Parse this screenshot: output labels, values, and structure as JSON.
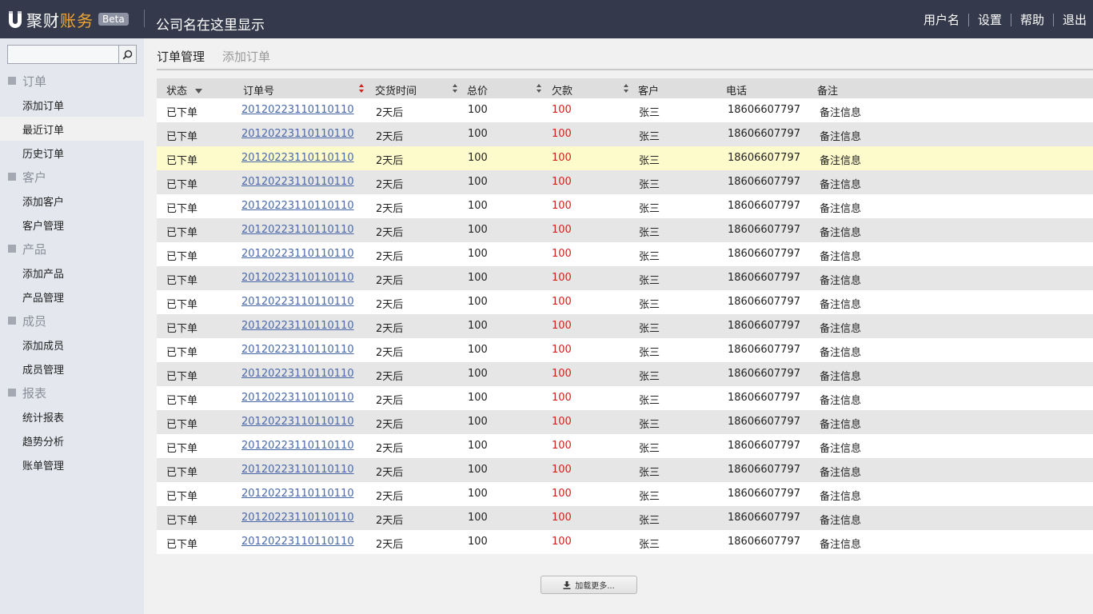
{
  "brand": {
    "name_a": "聚财",
    "name_b": "账务",
    "beta": "Beta",
    "accent": "#f0a632"
  },
  "company": "公司名在这里显示",
  "topnav": {
    "username": "用户名",
    "settings": "设置",
    "help": "帮助",
    "logout": "退出"
  },
  "search": {
    "placeholder": "",
    "icon": "search-icon"
  },
  "sidebar": {
    "groups": [
      {
        "title": "订单",
        "items": [
          "添加订单",
          "最近订单",
          "历史订单"
        ]
      },
      {
        "title": "客户",
        "items": [
          "添加客户",
          "客户管理"
        ]
      },
      {
        "title": "产品",
        "items": [
          "添加产品",
          "产品管理"
        ]
      },
      {
        "title": "成员",
        "items": [
          "添加成员",
          "成员管理"
        ]
      },
      {
        "title": "报表",
        "items": [
          "统计报表",
          "趋势分析",
          "账单管理"
        ]
      }
    ],
    "active_item": "最近订单"
  },
  "tabs": {
    "active": "订单管理",
    "inactive": "添加订单"
  },
  "table": {
    "headers": {
      "status": "状态",
      "order_no": "订单号",
      "delivery": "交货时间",
      "total": "总价",
      "debt": "欠款",
      "customer": "客户",
      "phone": "电话",
      "note": "备注"
    },
    "highlight_row": 3,
    "rows": [
      {
        "status": "已下单",
        "order_no": "20120223110110110",
        "delivery": "2天后",
        "total": "100",
        "debt": "100",
        "customer": "张三",
        "phone": "18606607797",
        "note": "备注信息"
      },
      {
        "status": "已下单",
        "order_no": "20120223110110110",
        "delivery": "2天后",
        "total": "100",
        "debt": "100",
        "customer": "张三",
        "phone": "18606607797",
        "note": "备注信息"
      },
      {
        "status": "已下单",
        "order_no": "20120223110110110",
        "delivery": "2天后",
        "total": "100",
        "debt": "100",
        "customer": "张三",
        "phone": "18606607797",
        "note": "备注信息"
      },
      {
        "status": "已下单",
        "order_no": "20120223110110110",
        "delivery": "2天后",
        "total": "100",
        "debt": "100",
        "customer": "张三",
        "phone": "18606607797",
        "note": "备注信息"
      },
      {
        "status": "已下单",
        "order_no": "20120223110110110",
        "delivery": "2天后",
        "total": "100",
        "debt": "100",
        "customer": "张三",
        "phone": "18606607797",
        "note": "备注信息"
      },
      {
        "status": "已下单",
        "order_no": "20120223110110110",
        "delivery": "2天后",
        "total": "100",
        "debt": "100",
        "customer": "张三",
        "phone": "18606607797",
        "note": "备注信息"
      },
      {
        "status": "已下单",
        "order_no": "20120223110110110",
        "delivery": "2天后",
        "total": "100",
        "debt": "100",
        "customer": "张三",
        "phone": "18606607797",
        "note": "备注信息"
      },
      {
        "status": "已下单",
        "order_no": "20120223110110110",
        "delivery": "2天后",
        "total": "100",
        "debt": "100",
        "customer": "张三",
        "phone": "18606607797",
        "note": "备注信息"
      },
      {
        "status": "已下单",
        "order_no": "20120223110110110",
        "delivery": "2天后",
        "total": "100",
        "debt": "100",
        "customer": "张三",
        "phone": "18606607797",
        "note": "备注信息"
      },
      {
        "status": "已下单",
        "order_no": "20120223110110110",
        "delivery": "2天后",
        "total": "100",
        "debt": "100",
        "customer": "张三",
        "phone": "18606607797",
        "note": "备注信息"
      },
      {
        "status": "已下单",
        "order_no": "20120223110110110",
        "delivery": "2天后",
        "total": "100",
        "debt": "100",
        "customer": "张三",
        "phone": "18606607797",
        "note": "备注信息"
      },
      {
        "status": "已下单",
        "order_no": "20120223110110110",
        "delivery": "2天后",
        "total": "100",
        "debt": "100",
        "customer": "张三",
        "phone": "18606607797",
        "note": "备注信息"
      },
      {
        "status": "已下单",
        "order_no": "20120223110110110",
        "delivery": "2天后",
        "total": "100",
        "debt": "100",
        "customer": "张三",
        "phone": "18606607797",
        "note": "备注信息"
      },
      {
        "status": "已下单",
        "order_no": "20120223110110110",
        "delivery": "2天后",
        "total": "100",
        "debt": "100",
        "customer": "张三",
        "phone": "18606607797",
        "note": "备注信息"
      },
      {
        "status": "已下单",
        "order_no": "20120223110110110",
        "delivery": "2天后",
        "total": "100",
        "debt": "100",
        "customer": "张三",
        "phone": "18606607797",
        "note": "备注信息"
      },
      {
        "status": "已下单",
        "order_no": "20120223110110110",
        "delivery": "2天后",
        "total": "100",
        "debt": "100",
        "customer": "张三",
        "phone": "18606607797",
        "note": "备注信息"
      },
      {
        "status": "已下单",
        "order_no": "20120223110110110",
        "delivery": "2天后",
        "total": "100",
        "debt": "100",
        "customer": "张三",
        "phone": "18606607797",
        "note": "备注信息"
      },
      {
        "status": "已下单",
        "order_no": "20120223110110110",
        "delivery": "2天后",
        "total": "100",
        "debt": "100",
        "customer": "张三",
        "phone": "18606607797",
        "note": "备注信息"
      },
      {
        "status": "已下单",
        "order_no": "20120223110110110",
        "delivery": "2天后",
        "total": "100",
        "debt": "100",
        "customer": "张三",
        "phone": "18606607797",
        "note": "备注信息"
      }
    ]
  },
  "load_more": {
    "label": "加载更多...",
    "icon": "download-icon"
  },
  "colors": {
    "topbar": "#343a4c",
    "link": "#4b69a8",
    "debt": "#d0221d",
    "highlight": "#fdfbcb",
    "sort_active": "#d0221d"
  }
}
